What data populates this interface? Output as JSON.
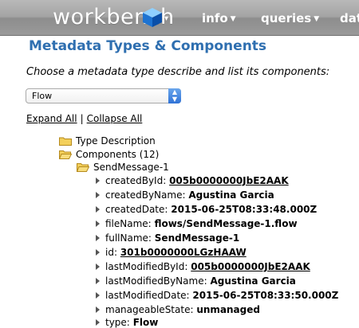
{
  "nav": {
    "logo": "workbench",
    "menus": [
      {
        "label": "info"
      },
      {
        "label": "queries"
      },
      {
        "label": "dat"
      }
    ]
  },
  "page": {
    "title": "Metadata Types & Components",
    "instruction": "Choose a metadata type describe and list its components:"
  },
  "type_select": {
    "value": "Flow"
  },
  "links": {
    "expand_all": "Expand All",
    "separator": "|",
    "collapse_all": "Collapse All"
  },
  "tree": {
    "type_description": "Type Description",
    "components": "Components (12)",
    "component_name": "SendMessage-1",
    "properties": [
      {
        "key": "createdById:",
        "value": "005b0000000JbE2AAK",
        "link": true
      },
      {
        "key": "createdByName:",
        "value": "Agustina Garcia",
        "link": false
      },
      {
        "key": "createdDate:",
        "value": "2015-06-25T08:33:48.000Z",
        "link": false
      },
      {
        "key": "fileName:",
        "value": "flows/SendMessage-1.flow",
        "link": false
      },
      {
        "key": "fullName:",
        "value": "SendMessage-1",
        "link": false
      },
      {
        "key": "id:",
        "value": "301b0000000LGzHAAW",
        "link": true
      },
      {
        "key": "lastModifiedById:",
        "value": "005b0000000JbE2AAK",
        "link": true
      },
      {
        "key": "lastModifiedByName:",
        "value": "Agustina Garcia",
        "link": false
      },
      {
        "key": "lastModifiedDate:",
        "value": "2015-06-25T08:33:50.000Z",
        "link": false
      },
      {
        "key": "manageableState:",
        "value": "unmanaged",
        "link": false
      },
      {
        "key": "type:",
        "value": "Flow",
        "link": false
      }
    ]
  }
}
